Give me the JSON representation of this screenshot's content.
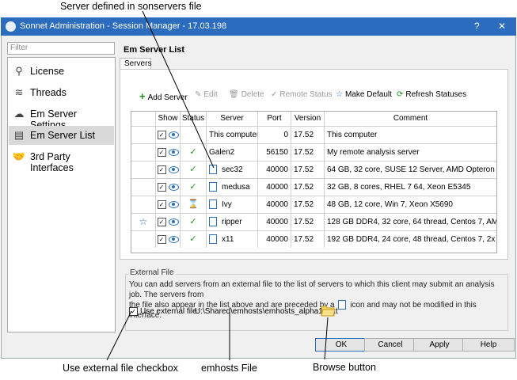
{
  "callouts": {
    "top": "Server defined in sonservers file",
    "checkbox": "Use external file checkbox",
    "file": "emhosts File",
    "browse": "Browse button"
  },
  "window": {
    "title": "Sonnet Administration - Session Manager - 17.03.198",
    "help_btn": "?",
    "close_btn": "✕"
  },
  "filter": {
    "placeholder": "Filter"
  },
  "nav": [
    {
      "label": "License",
      "icon": "key-icon"
    },
    {
      "label": "Threads",
      "icon": "threads-icon"
    },
    {
      "label": "Em Server Settings",
      "icon": "server-settings-icon"
    },
    {
      "label": "Em Server List",
      "icon": "server-list-icon",
      "selected": true
    },
    {
      "label": "3rd Party Interfaces",
      "icon": "handshake-icon"
    }
  ],
  "page": {
    "heading": "Em Server List",
    "tab": "Servers"
  },
  "toolbar": {
    "add": "Add Server",
    "edit": "Edit",
    "delete": "Delete",
    "remote": "Remote Status",
    "default": "Make Default",
    "refresh": "Refresh Statuses"
  },
  "columns": [
    "Show",
    "Status",
    "Server",
    "Port",
    "Version",
    "Comment"
  ],
  "rows": [
    {
      "default": false,
      "status": "",
      "doc": false,
      "server": "This computer",
      "port": "0",
      "version": "17.52",
      "comment": "This computer"
    },
    {
      "default": false,
      "status": "✓",
      "doc": false,
      "server": "Galen2",
      "port": "56150",
      "version": "17.52",
      "comment": "My remote analysis server"
    },
    {
      "default": false,
      "status": "✓",
      "doc": true,
      "server": "sec32",
      "port": "40000",
      "version": "17.52",
      "comment": "64 GB, 32 core, SUSE 12 Server, AMD Opteron 6386 SE"
    },
    {
      "default": false,
      "status": "✓",
      "doc": true,
      "server": "medusa",
      "port": "40000",
      "version": "17.52",
      "comment": "32 GB, 8 cores, RHEL 7 64, Xeon E5345"
    },
    {
      "default": false,
      "status": "⌛",
      "doc": true,
      "server": "Ivy",
      "port": "40000",
      "version": "17.52",
      "comment": "48 GB, 12 core, Win 7, Xeon X5690"
    },
    {
      "default": true,
      "status": "✓",
      "doc": true,
      "server": "ripper",
      "port": "40000",
      "version": "17.52",
      "comment": "128 GB DDR4, 32 core, 64 thread, Centos 7, AMD Ry..."
    },
    {
      "default": false,
      "status": "✓",
      "doc": true,
      "server": "x11",
      "port": "40000",
      "version": "17.52",
      "comment": "192 GB DDR4, 24 core, 48 thread, Centos 7, 2x Xeon ..."
    }
  ],
  "external": {
    "group_label": "External File",
    "desc1": "You can add servers from an external file to the list of servers to which this client may submit an analysis job. The servers from",
    "desc2a": "the file also appear in the list above and are preceded by a",
    "desc2b": "icon and may not be modified in this interface.",
    "use_label": "Use external file:",
    "path": "U:\\Shared\\emhosts\\emhosts_alpha17.txt"
  },
  "buttons": {
    "ok": "OK",
    "cancel": "Cancel",
    "apply": "Apply",
    "help": "Help"
  },
  "colors": {
    "titlebar": "#2b6cbf",
    "check": "#2e8b2e",
    "star": "#2d6fb8"
  }
}
